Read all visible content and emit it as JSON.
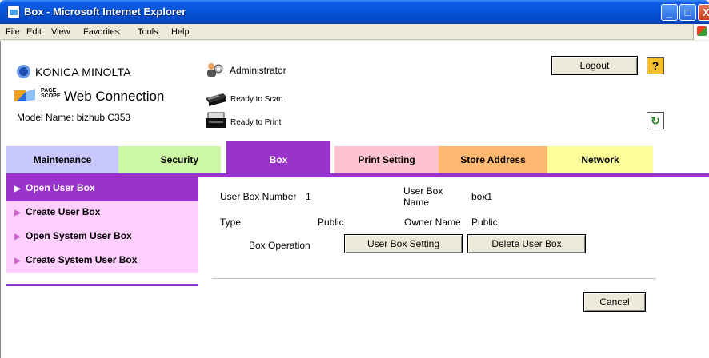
{
  "window": {
    "title": "Box - Microsoft Internet Explorer",
    "min_label": "_",
    "max_label": "□",
    "close_label": "X"
  },
  "menu": [
    "File",
    "Edit",
    "View",
    "Favorites",
    "Tools",
    "Help"
  ],
  "header": {
    "brand": "KONICA MINOLTA",
    "page_scope_line1": "PAGE",
    "page_scope_line2": "SCOPE",
    "product": "Web Connection",
    "model_name": "Model Name: bizhub C353",
    "user": "Administrator",
    "scan_status": "Ready to Scan",
    "print_status": "Ready to Print",
    "logout": "Logout",
    "help": "?",
    "refresh": "↻"
  },
  "tabs": {
    "maintenance": "Maintenance",
    "security": "Security",
    "box": "Box",
    "print_setting": "Print Setting",
    "store_address": "Store Address",
    "network": "Network"
  },
  "sidebar": {
    "arrow": "▶",
    "items": [
      "Open User Box",
      "Create User Box",
      "Open System User Box",
      "Create System User Box"
    ]
  },
  "content": {
    "box_number_label": "User Box Number",
    "box_number_value": "1",
    "box_name_label_1": "User Box",
    "box_name_label_2": "Name",
    "box_name_value": "box1",
    "type_label": "Type",
    "type_value": "Public",
    "owner_label": "Owner Name",
    "owner_value": "Public",
    "operation_label": "Box Operation",
    "user_box_setting": "User Box Setting",
    "delete_user_box": "Delete User Box",
    "cancel": "Cancel"
  },
  "colors": {
    "box_tab": "#9933cc",
    "maintenance_tab": "#c8c8ff",
    "security_tab": "#cdf8a6",
    "print_tab": "#ffc2d2",
    "store_tab": "#ffb870",
    "network_tab": "#ffff99"
  }
}
